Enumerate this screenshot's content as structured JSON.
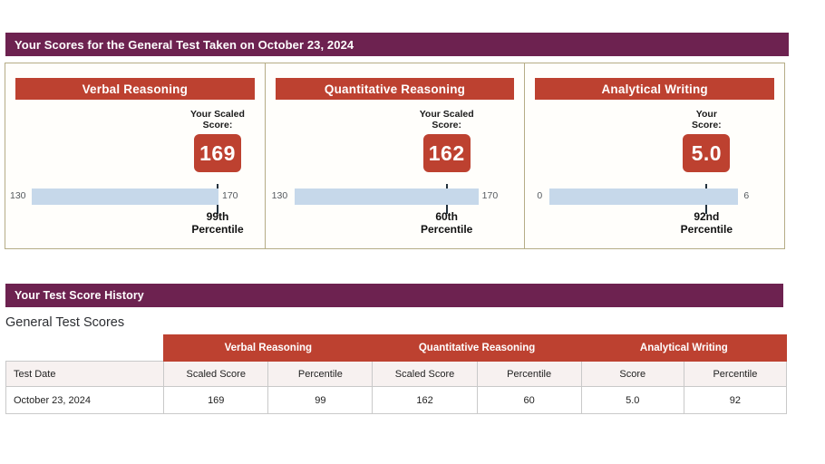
{
  "scores_banner": {
    "title": "Your Scores for the General Test Taken on October 23, 2024"
  },
  "history_banner": {
    "title": "Your Test Score History"
  },
  "general_scores_title": "General Test Scores",
  "cards": [
    {
      "title": "Verbal Reasoning",
      "score_label": "Your Scaled\nScore:",
      "score": "169",
      "scale_min": "130",
      "scale_max": "170",
      "percentile": "99th\nPercentile"
    },
    {
      "title": "Quantitative Reasoning",
      "score_label": "Your Scaled\nScore:",
      "score": "162",
      "scale_min": "130",
      "scale_max": "170",
      "percentile": "60th\nPercentile"
    },
    {
      "title": "Analytical Writing",
      "score_label": "Your\nScore:",
      "score": "5.0",
      "scale_min": "0",
      "scale_max": "6",
      "percentile": "92nd\nPercentile"
    }
  ],
  "table": {
    "group_headers": [
      "Verbal Reasoning",
      "Quantitative Reasoning",
      "Analytical Writing"
    ],
    "sub_headers": [
      "Test Date",
      "Scaled Score",
      "Percentile",
      "Scaled Score",
      "Percentile",
      "Score",
      "Percentile"
    ],
    "rows": [
      [
        "October 23, 2024",
        "169",
        "99",
        "162",
        "60",
        "5.0",
        "92"
      ]
    ]
  },
  "chart_data": {
    "type": "bar",
    "title": "Your Scores for the General Test Taken on October 23, 2024",
    "categories": [
      "Verbal Reasoning",
      "Quantitative Reasoning",
      "Analytical Writing"
    ],
    "series": [
      {
        "name": "Scaled Score",
        "values": [
          169,
          162,
          5.0
        ]
      },
      {
        "name": "Percentile",
        "values": [
          99,
          60,
          92
        ]
      }
    ],
    "axis_ranges": [
      [
        130,
        170
      ],
      [
        130,
        170
      ],
      [
        0,
        6
      ]
    ],
    "xlabel": "",
    "ylabel": "",
    "grid": false,
    "legend": "none"
  },
  "colors": {
    "banner_purple": "#6d2250",
    "accent_red": "#bd4130",
    "scale_blue": "#c6d8ea",
    "container_border": "#b5ac86",
    "pointer": "#23313d"
  }
}
